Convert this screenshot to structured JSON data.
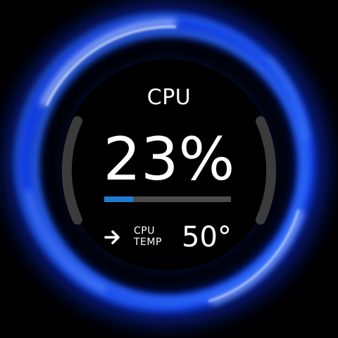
{
  "widget": {
    "title": "CPU",
    "usage_percent_text": "23%",
    "usage_fraction": 0.23,
    "temp_label_line1": "CPU",
    "temp_label_line2": "TEMP",
    "temp_value": "50°",
    "arrow_icon": "arrow-right-icon",
    "colors": {
      "accent": "#1e7ad3",
      "bar_track": "#4b4b4b",
      "glow": "#1f5cff",
      "bracket": "#3b3b3b"
    }
  }
}
